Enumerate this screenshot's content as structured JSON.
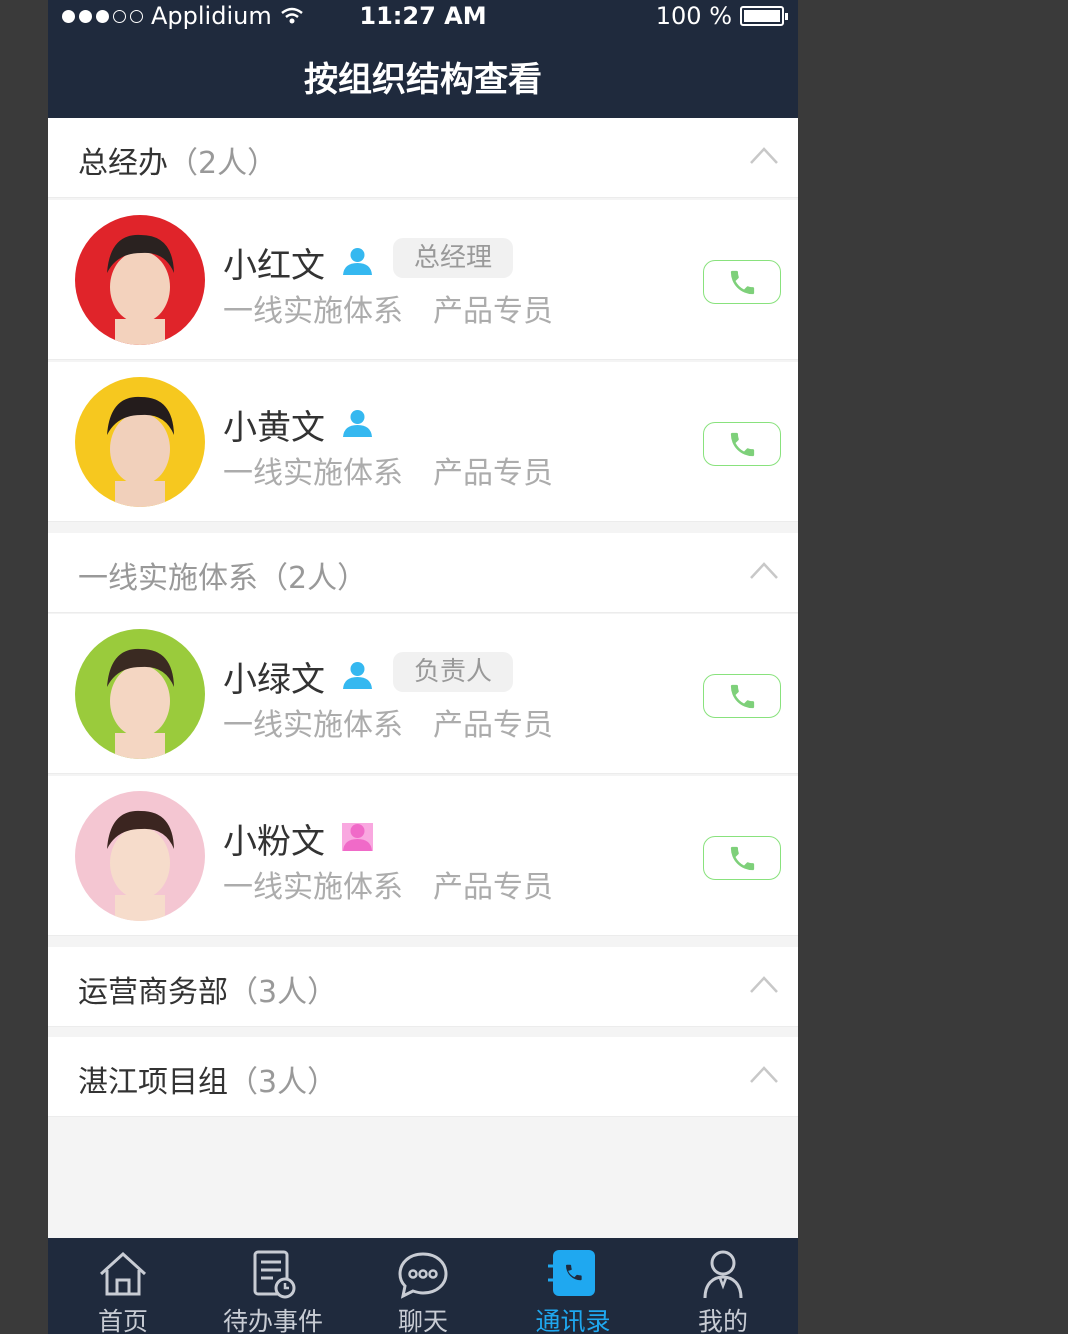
{
  "status_bar": {
    "carrier": "Applidium",
    "time": "11:27 AM",
    "battery_text": "100 %",
    "battery_level": 1.0
  },
  "header": {
    "title": "按组织结构查看"
  },
  "groups": [
    {
      "name": "总经办",
      "count": "（2人）",
      "expanded": true,
      "members": [
        {
          "name": "小红文",
          "icon": "person-icon",
          "icon_color": "#35b8f0",
          "tag": "总经理",
          "dept": "一线实施体系",
          "role": "产品专员",
          "avatar_bg": "#e0242a"
        },
        {
          "name": "小黄文",
          "icon": "person-icon",
          "icon_color": "#35b8f0",
          "tag": "",
          "dept": "一线实施体系",
          "role": "产品专员",
          "avatar_bg": "#f6c81f"
        }
      ]
    },
    {
      "name": "一线实施体系",
      "count": "（2人）",
      "expanded": true,
      "members": [
        {
          "name": "小绿文",
          "icon": "person-icon",
          "icon_color": "#35b8f0",
          "tag": "负责人",
          "dept": "一线实施体系",
          "role": "产品专员",
          "avatar_bg": "#9acb3c"
        },
        {
          "name": "小粉文",
          "icon": "person-icon",
          "icon_color": "#f06ac8",
          "tag": "",
          "dept": "一线实施体系",
          "role": "产品专员",
          "avatar_bg": "#f4c6d2"
        }
      ]
    },
    {
      "name": "运营商务部",
      "count": "（3人）",
      "expanded": false
    },
    {
      "name": "湛江项目组",
      "count": "（3人）",
      "expanded": false
    }
  ],
  "tab_bar": {
    "active_index": 3,
    "active_color": "#1fa8f0",
    "tabs": [
      {
        "label": "首页",
        "icon": "home-icon"
      },
      {
        "label": "待办事件",
        "icon": "todo-icon"
      },
      {
        "label": "聊天",
        "icon": "chat-icon"
      },
      {
        "label": "通讯录",
        "icon": "contacts-icon"
      },
      {
        "label": "我的",
        "icon": "profile-icon"
      }
    ]
  },
  "colors": {
    "header_bg": "#1f2a3d",
    "page_bg": "#f4f4f4",
    "call_border": "rgba(59,207,39,0.6)",
    "call_icon": "#7ed07a"
  }
}
